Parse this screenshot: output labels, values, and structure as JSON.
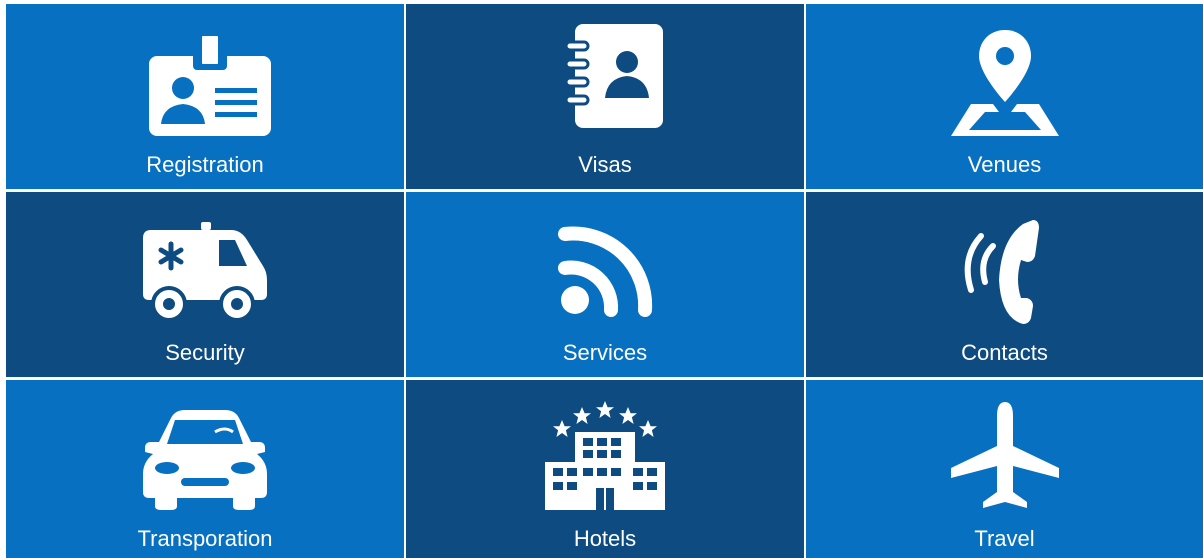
{
  "tiles": [
    {
      "label": "Registration",
      "icon": "id-badge-icon",
      "shade": "light"
    },
    {
      "label": "Visas",
      "icon": "contact-book-icon",
      "shade": "dark"
    },
    {
      "label": "Venues",
      "icon": "map-pin-icon",
      "shade": "light"
    },
    {
      "label": "Security",
      "icon": "ambulance-icon",
      "shade": "dark"
    },
    {
      "label": "Services",
      "icon": "rss-feed-icon",
      "shade": "light"
    },
    {
      "label": "Contacts",
      "icon": "phone-call-icon",
      "shade": "dark"
    },
    {
      "label": "Transporation",
      "icon": "car-icon",
      "shade": "light"
    },
    {
      "label": "Hotels",
      "icon": "five-star-hotel-icon",
      "shade": "dark"
    },
    {
      "label": "Travel",
      "icon": "airplane-icon",
      "shade": "light"
    }
  ],
  "colors": {
    "light": "#0770c0",
    "dark": "#0d4b80",
    "foreground": "#ffffff",
    "divider": "#ffffff"
  }
}
